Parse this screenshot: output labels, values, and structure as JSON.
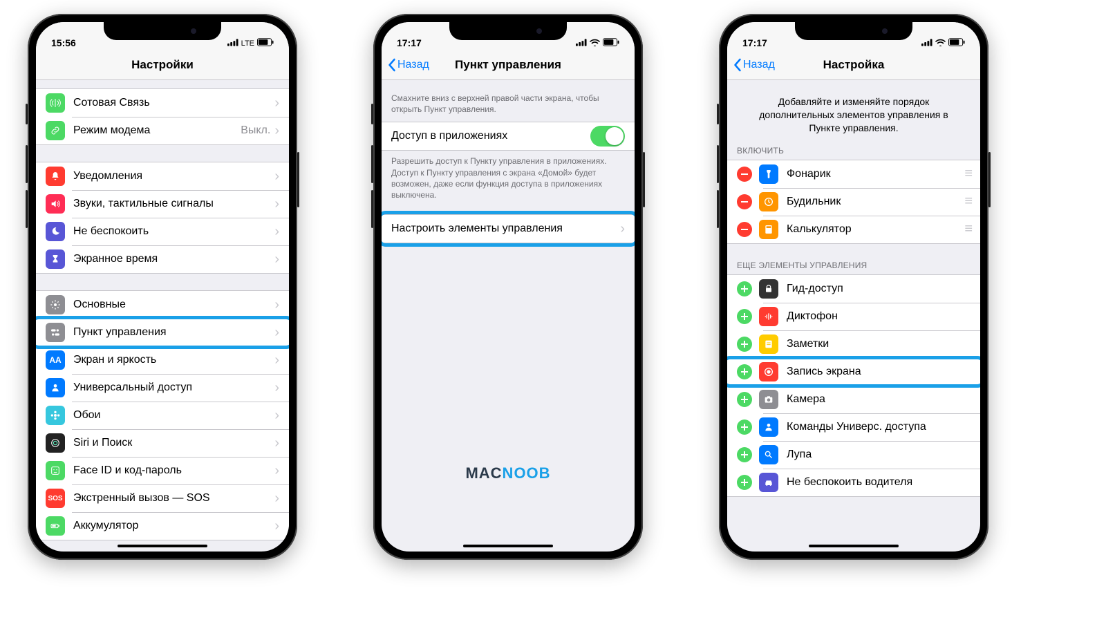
{
  "watermark": {
    "part1": "MAC",
    "part2": "NOOB"
  },
  "phone1": {
    "time": "15:56",
    "signal_label": "LTE",
    "nav": {
      "title": "Настройки"
    },
    "groups": [
      {
        "rows": [
          {
            "id": "cellular",
            "icon_bg": "#4cd964",
            "icon": "antenna",
            "label": "Сотовая Связь",
            "detail": ""
          },
          {
            "id": "hotspot",
            "icon_bg": "#4cd964",
            "icon": "link",
            "label": "Режим модема",
            "detail": "Выкл."
          }
        ]
      },
      {
        "rows": [
          {
            "id": "notifications",
            "icon_bg": "#ff3b30",
            "icon": "bell",
            "label": "Уведомления"
          },
          {
            "id": "sounds",
            "icon_bg": "#ff2d55",
            "icon": "speaker",
            "label": "Звуки, тактильные сигналы"
          },
          {
            "id": "dnd",
            "icon_bg": "#5856d6",
            "icon": "moon",
            "label": "Не беспокоить"
          },
          {
            "id": "screentime",
            "icon_bg": "#5856d6",
            "icon": "hourglass",
            "label": "Экранное время"
          }
        ]
      },
      {
        "rows": [
          {
            "id": "general",
            "icon_bg": "#8e8e93",
            "icon": "gear",
            "label": "Основные"
          },
          {
            "id": "control-center",
            "icon_bg": "#8e8e93",
            "icon": "switches",
            "label": "Пункт управления",
            "highlight": true
          },
          {
            "id": "display",
            "icon_bg": "#007aff",
            "icon": "aa",
            "label": "Экран и яркость"
          },
          {
            "id": "accessibility",
            "icon_bg": "#007aff",
            "icon": "person",
            "label": "Универсальный доступ"
          },
          {
            "id": "wallpaper",
            "icon_bg": "#36c7de",
            "icon": "flower",
            "label": "Обои"
          },
          {
            "id": "siri",
            "icon_bg": "#222",
            "icon": "siri",
            "label": "Siri и Поиск"
          },
          {
            "id": "faceid",
            "icon_bg": "#4cd964",
            "icon": "face",
            "label": "Face ID и код-пароль"
          },
          {
            "id": "sos",
            "icon_bg": "#ff3b30",
            "icon": "sos",
            "label": "Экстренный вызов — SOS"
          },
          {
            "id": "battery",
            "icon_bg": "#4cd964",
            "icon": "battery",
            "label": "Аккумулятор"
          }
        ]
      }
    ]
  },
  "phone2": {
    "time": "17:17",
    "nav": {
      "back": "Назад",
      "title": "Пункт управления"
    },
    "intro": "Смахните вниз с верхней правой части экрана, чтобы открыть Пункт управления.",
    "toggle_row": {
      "label": "Доступ в приложениях"
    },
    "toggle_footer": "Разрешить доступ к Пункту управления в приложениях. Доступ к Пункту управления с экрана «Домой» будет возможен, даже если функция доступа в приложениях выключена.",
    "customize_row": {
      "label": "Настроить элементы управления",
      "highlight": true
    }
  },
  "phone3": {
    "time": "17:17",
    "nav": {
      "back": "Назад",
      "title": "Настройка"
    },
    "intro": "Добавляйте и изменяйте порядок дополнительных элементов управления в Пункте управления.",
    "include_header": "ВКЛЮЧИТЬ",
    "include": [
      {
        "id": "flashlight",
        "icon_bg": "#007aff",
        "icon": "flashlight",
        "label": "Фонарик"
      },
      {
        "id": "alarm",
        "icon_bg": "#ff9500",
        "icon": "clock",
        "label": "Будильник"
      },
      {
        "id": "calculator",
        "icon_bg": "#ff9500",
        "icon": "calc",
        "label": "Калькулятор"
      }
    ],
    "more_header": "ЕЩЕ ЭЛЕМЕНТЫ УПРАВЛЕНИЯ",
    "more": [
      {
        "id": "guided",
        "icon_bg": "#333",
        "icon": "lock",
        "label": "Гид-доступ"
      },
      {
        "id": "voice-memos",
        "icon_bg": "#ff3b30",
        "icon": "wave",
        "label": "Диктофон"
      },
      {
        "id": "notes",
        "icon_bg": "#ffcc00",
        "icon": "note",
        "label": "Заметки"
      },
      {
        "id": "screen-record",
        "icon_bg": "#ff3b30",
        "icon": "record",
        "label": "Запись экрана",
        "highlight": true
      },
      {
        "id": "camera",
        "icon_bg": "#8e8e93",
        "icon": "camera",
        "label": "Камера"
      },
      {
        "id": "a11y-shortcut",
        "icon_bg": "#007aff",
        "icon": "person",
        "label": "Команды Универс. доступа"
      },
      {
        "id": "magnifier",
        "icon_bg": "#007aff",
        "icon": "search",
        "label": "Лупа"
      },
      {
        "id": "driving",
        "icon_bg": "#5856d6",
        "icon": "car",
        "label": "Не беспокоить водителя"
      }
    ]
  }
}
